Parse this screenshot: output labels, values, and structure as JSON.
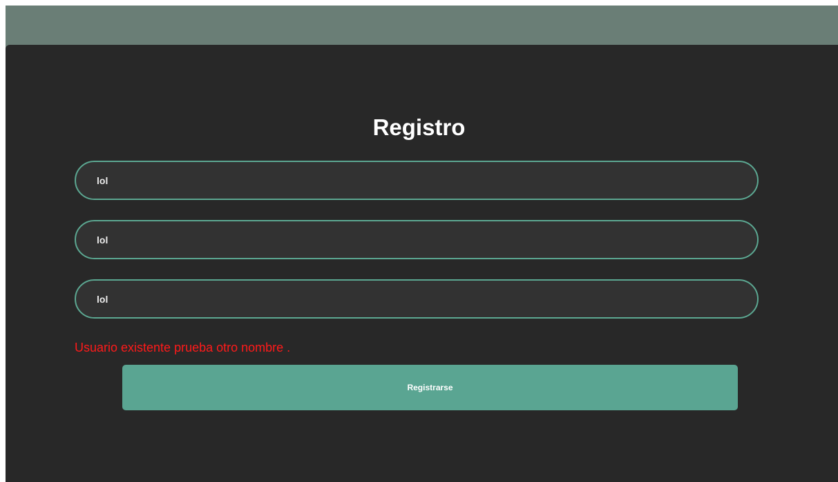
{
  "form": {
    "title": "Registro",
    "fields": [
      {
        "value": "lol"
      },
      {
        "value": "lol"
      },
      {
        "value": "lol"
      }
    ],
    "error_message": "Usuario existente prueba otro nombre .",
    "submit_label": "Registrarse"
  },
  "colors": {
    "header_band": "#6a7e76",
    "card_background": "#282828",
    "field_border": "#5ca892",
    "button_background": "#5aa592",
    "error_text": "#ff1a1a"
  }
}
